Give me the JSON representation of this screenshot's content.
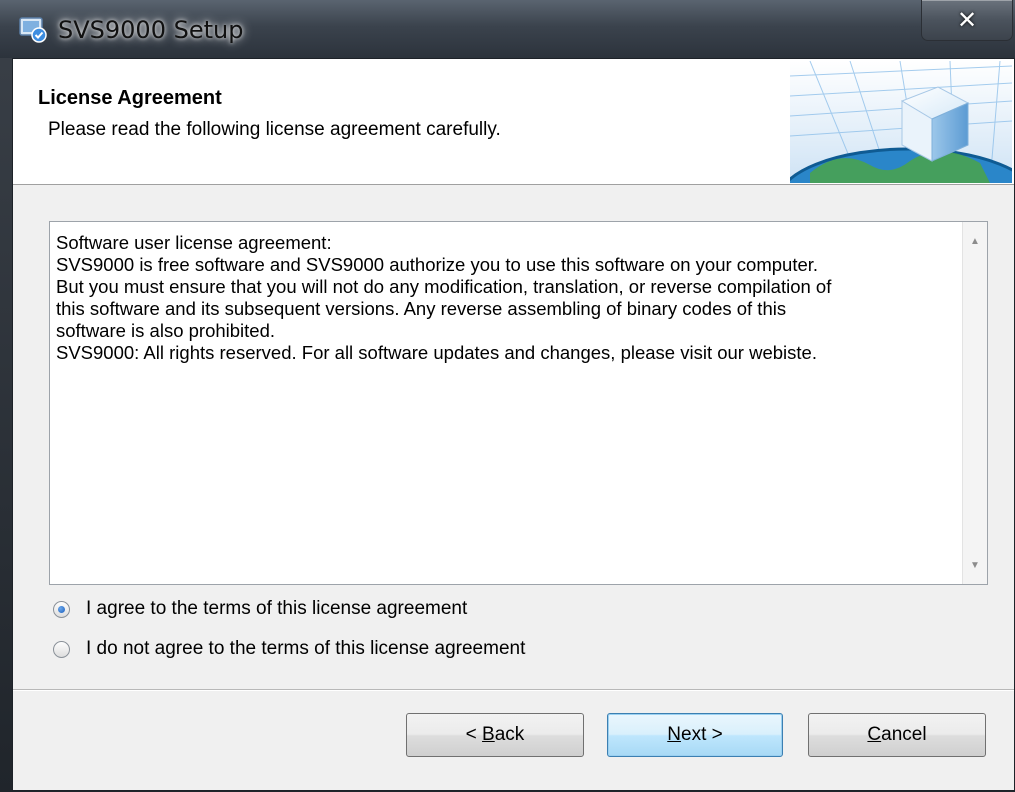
{
  "window": {
    "title": "SVS9000 Setup",
    "close_glyph": "✕"
  },
  "header": {
    "title": "License Agreement",
    "subtitle": "Please read the following license agreement carefully."
  },
  "license": {
    "lines": [
      "Software user license agreement:",
      "SVS9000 is free software and SVS9000 authorize you to use this software on your computer.",
      "But you must ensure that you will not do any  modification, translation, or reverse compilation of",
      "this software and its subsequent versions. Any reverse assembling of binary codes of this",
      "software is also prohibited.",
      "SVS9000: All rights reserved. For all software updates and changes, please visit our webiste."
    ],
    "scroll_up_glyph": "▲",
    "scroll_down_glyph": "▼"
  },
  "options": {
    "agree": {
      "label": "I agree to the terms of this license agreement",
      "checked": true
    },
    "disagree": {
      "label": "I do not agree to the terms of this license agreement",
      "checked": false
    }
  },
  "buttons": {
    "back": {
      "prefix": "< ",
      "mnemonic": "B",
      "rest": "ack"
    },
    "next": {
      "mnemonic": "N",
      "rest": "ext >"
    },
    "cancel": {
      "mnemonic": "C",
      "rest": "ancel"
    }
  },
  "icons": {
    "app": "setup-app-icon",
    "header_art": "cube-globe-graphic",
    "close": "close-icon"
  },
  "colors": {
    "accent": "#3c7fb1",
    "radio_dot": "#1c5fbf"
  }
}
